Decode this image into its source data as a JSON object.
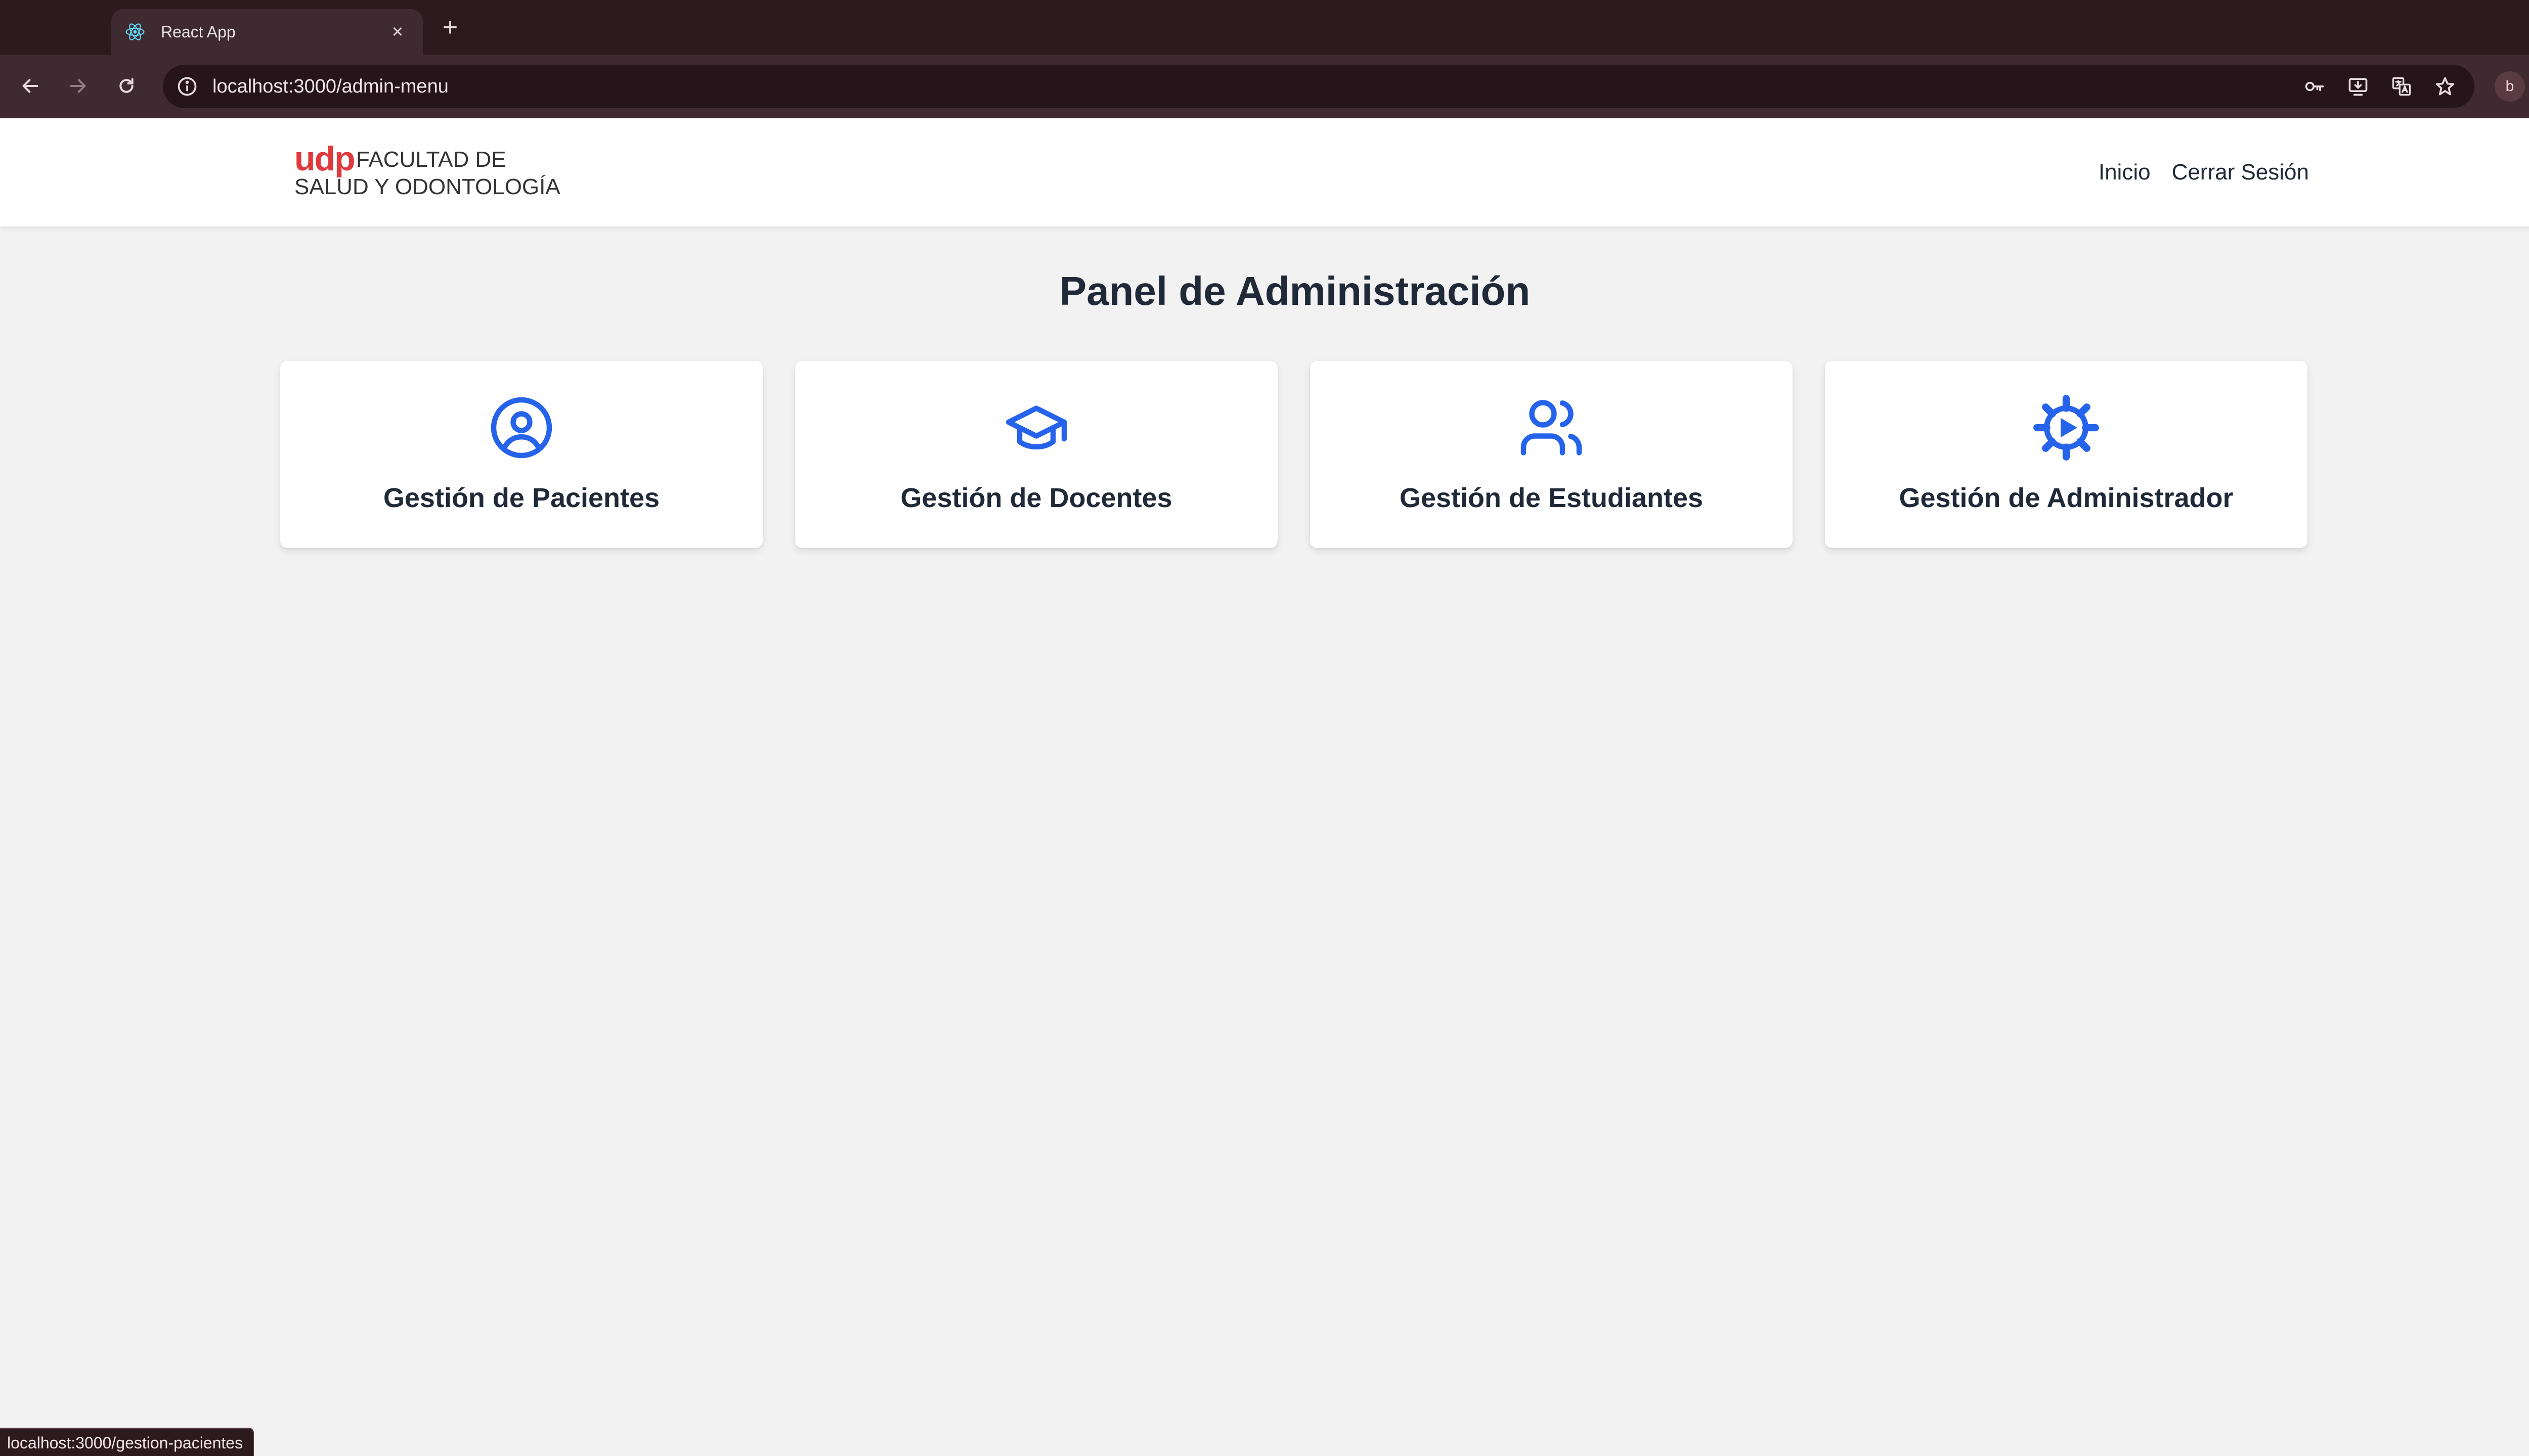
{
  "browser": {
    "tab": {
      "title": "React App",
      "favicon": "react-icon"
    },
    "address_bar": {
      "url": "localhost:3000/admin-menu"
    },
    "profile_initial": "b",
    "status_bubble": "localhost:3000/gestion-pacientes"
  },
  "header": {
    "logo": {
      "brand": "udp",
      "line1": "FACULTAD DE",
      "line2": "SALUD Y ODONTOLOGÍA",
      "brand_color": "#e03a3e"
    },
    "nav": [
      {
        "label": "Inicio"
      },
      {
        "label": "Cerrar Sesión"
      }
    ]
  },
  "main": {
    "title": "Panel de Administración",
    "accent_color": "#2563eb",
    "cards": [
      {
        "label": "Gestión de Pacientes",
        "icon": "user-circle-icon"
      },
      {
        "label": "Gestión de Docentes",
        "icon": "graduation-cap-icon"
      },
      {
        "label": "Gestión de Estudiantes",
        "icon": "users-icon"
      },
      {
        "label": "Gestión de Administrador",
        "icon": "gear-icon"
      }
    ]
  }
}
